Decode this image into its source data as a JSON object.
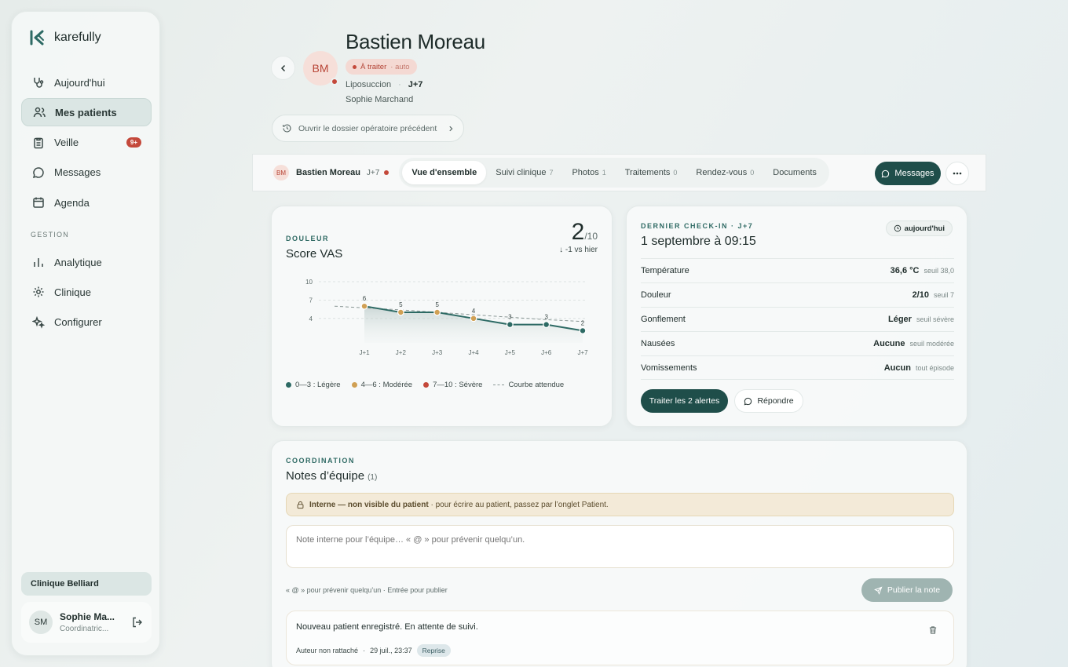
{
  "app": {
    "name": "karefully"
  },
  "sidebar": {
    "items": [
      {
        "label": "Aujourd'hui",
        "icon": "stethoscope-icon"
      },
      {
        "label": "Mes patients",
        "icon": "users-icon",
        "active": true
      },
      {
        "label": "Veille",
        "icon": "clipboard-icon",
        "badge": "9+"
      },
      {
        "label": "Messages",
        "icon": "chat-icon"
      },
      {
        "label": "Agenda",
        "icon": "calendar-icon"
      }
    ],
    "section_label": "GESTION",
    "manage_items": [
      {
        "label": "Analytique",
        "icon": "bar-chart-icon"
      },
      {
        "label": "Clinique",
        "icon": "gear-icon"
      },
      {
        "label": "Configurer",
        "icon": "sparkles-icon"
      }
    ],
    "clinic": "Clinique Belliard",
    "user": {
      "initials": "SM",
      "name": "Sophie Ma...",
      "role": "Coordinatric..."
    }
  },
  "patient": {
    "initials": "BM",
    "name": "Bastien Moreau",
    "status": "À traiter",
    "status_auto": "· auto",
    "procedure": "Liposuccion",
    "sep": "·",
    "day": "J+7",
    "surgeon": "Sophie Marchand",
    "dossier_link": "Ouvrir le dossier opératoire précédent"
  },
  "tabbar": {
    "initials": "BM",
    "name": "Bastien Moreau",
    "day": "J+7",
    "tabs": [
      {
        "label": "Vue d'ensemble",
        "count": "",
        "active": true
      },
      {
        "label": "Suivi clinique",
        "count": "7"
      },
      {
        "label": "Photos",
        "count": "1"
      },
      {
        "label": "Traitements",
        "count": "0"
      },
      {
        "label": "Rendez-vous",
        "count": "0"
      },
      {
        "label": "Documents",
        "count": ""
      }
    ],
    "messages_label": "Messages"
  },
  "pain": {
    "overline": "DOULEUR",
    "title": "Score VAS",
    "score": "2",
    "denominator": "/10",
    "delta": "↓ -1 vs hier",
    "legend": [
      {
        "label": "0—3 : Légère",
        "color": "#2d6a64"
      },
      {
        "label": "4—6 : Modérée",
        "color": "#d0a054"
      },
      {
        "label": "7—10 : Sévère",
        "color": "#c4493b"
      },
      {
        "label": "Courbe attendue",
        "dashed": true
      }
    ]
  },
  "chart_data": {
    "type": "line",
    "categories": [
      "J+1",
      "J+2",
      "J+3",
      "J+4",
      "J+5",
      "J+6",
      "J+7"
    ],
    "series": [
      {
        "values": [
          6,
          5,
          5,
          4,
          3,
          3,
          2
        ],
        "color": "#2d6a64"
      },
      {
        "values": [
          6,
          5.4,
          5,
          4.6,
          4.2,
          3.8,
          3.5
        ],
        "color": "#8a9795",
        "dashed": true
      }
    ],
    "yticks": [
      4,
      7,
      10
    ],
    "ylim": [
      0,
      10
    ],
    "point_colors": [
      "#d0a054",
      "#d0a054",
      "#d0a054",
      "#d0a054",
      "#2d6a64",
      "#2d6a64",
      "#2d6a64"
    ],
    "grid": true
  },
  "checkin": {
    "overline": "DERNIER CHECK-IN · J+7",
    "title": "1 septembre à 09:15",
    "today": "aujourd'hui",
    "rows": [
      {
        "label": "Température",
        "value": "36,6 °C",
        "threshold": "seuil 38,0"
      },
      {
        "label": "Douleur",
        "value": "2/10",
        "threshold": "seuil 7"
      },
      {
        "label": "Gonflement",
        "value": "Léger",
        "threshold": "seuil sévère"
      },
      {
        "label": "Nausées",
        "value": "Aucune",
        "threshold": "seuil modérée"
      },
      {
        "label": "Vomissements",
        "value": "Aucun",
        "threshold": "tout épisode"
      }
    ],
    "treat_label": "Traiter les 2 alertes",
    "reply_label": "Répondre"
  },
  "notes": {
    "overline": "COORDINATION",
    "title": "Notes d’équipe",
    "count": "(1)",
    "warn_bold": "Interne — non visible du patient",
    "warn_rest": " · pour écrire au patient, passez par l’onglet Patient.",
    "placeholder": "Note interne pour l’équipe… « @ » pour prévenir quelqu’un.",
    "hint": "« @ » pour prévenir quelqu’un · Entrée pour publier",
    "publish_label": "Publier la note",
    "items": [
      {
        "text": "Nouveau patient enregistré. En attente de suivi.",
        "author": "Auteur non rattaché",
        "sep": "·",
        "date": "29 juil., 23:37",
        "tag": "Reprise"
      }
    ]
  }
}
